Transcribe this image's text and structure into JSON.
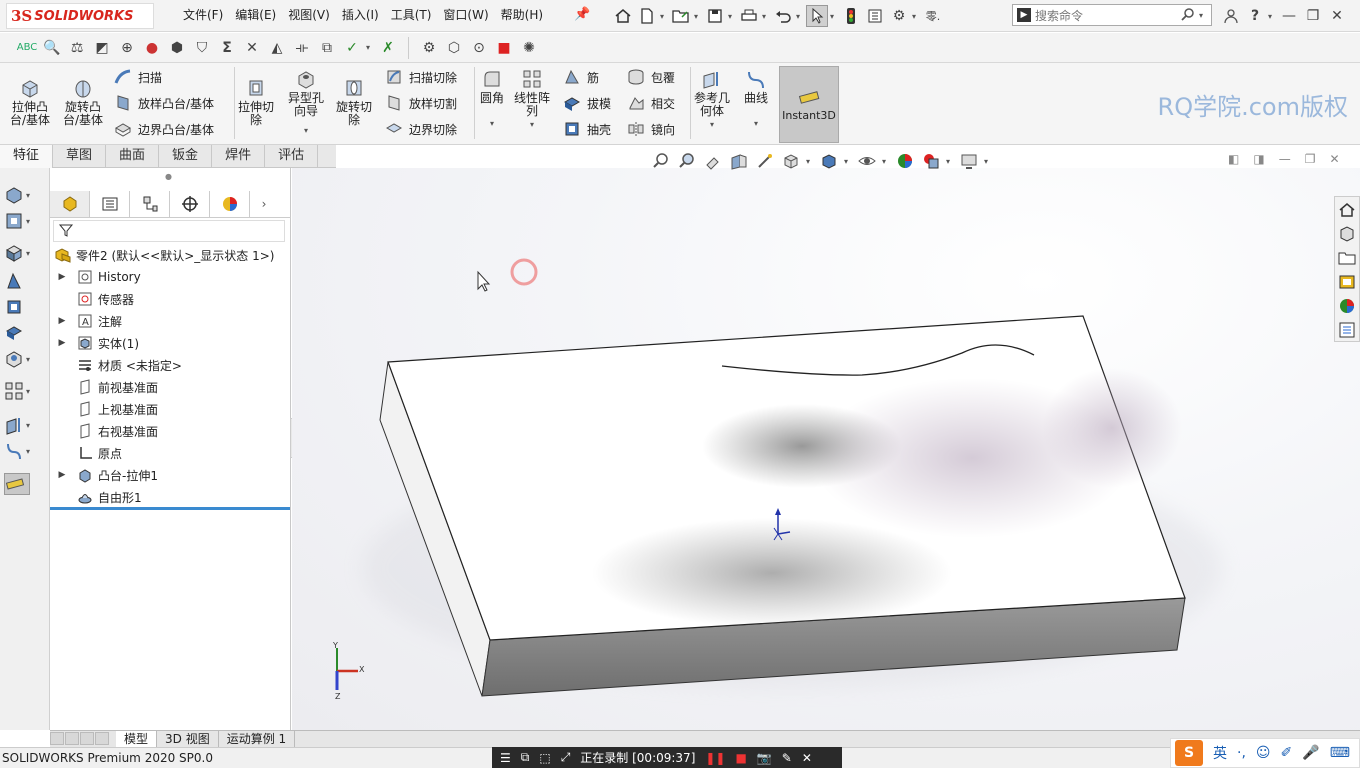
{
  "app": {
    "logo_ds": "3S",
    "logo_name": "SOLIDWORKS",
    "status": "SOLIDWORKS Premium 2020 SP0.0",
    "watermark": "RQ学院.com版权"
  },
  "menu": [
    "文件(F)",
    "编辑(E)",
    "视图(V)",
    "插入(I)",
    "工具(T)",
    "窗口(W)",
    "帮助(H)"
  ],
  "search": {
    "placeholder": "搜索命令"
  },
  "ribbon": {
    "extrude_boss": "拉伸凸\n台/基体",
    "revolve_boss": "旋转凸\n台/基体",
    "sweep": "扫描",
    "loft_boss": "放样凸台/基体",
    "boundary_boss": "边界凸台/基体",
    "extrude_cut": "拉伸切\n除",
    "hole_wizard": "异型孔\n向导",
    "revolve_cut": "旋转切\n除",
    "swept_cut": "扫描切除",
    "lofted_cut": "放样切割",
    "boundary_cut": "边界切除",
    "fillet": "圆角",
    "linear_pattern": "线性阵\n列",
    "rib": "筋",
    "draft": "拔模",
    "shell": "抽壳",
    "wrap": "包覆",
    "intersect": "相交",
    "mirror": "镜向",
    "ref_geometry": "参考几\n何体",
    "curves": "曲线",
    "instant3d": "Instant3D"
  },
  "tabs": [
    "特征",
    "草图",
    "曲面",
    "钣金",
    "焊件",
    "评估"
  ],
  "tree": {
    "root": "零件2 (默认<<默认>_显示状态 1>)",
    "items": [
      "History",
      "传感器",
      "注解",
      "实体(1)",
      "材质 <未指定>",
      "前视基准面",
      "上视基准面",
      "右视基准面",
      "原点",
      "凸台-拉伸1",
      "自由形1"
    ]
  },
  "bottom_tabs": [
    "模型",
    "3D 视图",
    "运动算例 1"
  ],
  "recording": {
    "text": "正在录制 [00:09:37]"
  },
  "ime": {
    "lang": "英"
  },
  "triad": {
    "x": "X",
    "y": "Y",
    "z": "Z"
  },
  "colors": {
    "accent": "#3a8ad0",
    "brand": "#d8261d",
    "watermark": "#9bb8dc"
  }
}
